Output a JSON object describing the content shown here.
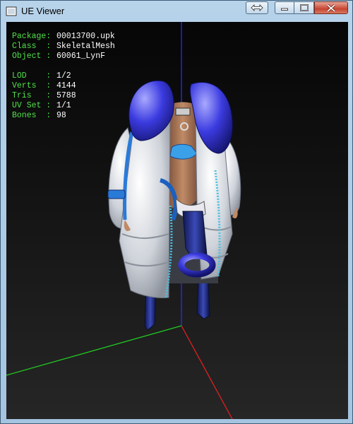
{
  "window": {
    "title": "UE Viewer"
  },
  "info": {
    "package": {
      "key": "Package:",
      "value": "00013700.upk"
    },
    "class": {
      "key": "Class  :",
      "value": "SkeletalMesh"
    },
    "object": {
      "key": "Object :",
      "value": "60061_LynF"
    },
    "lod": {
      "key": "LOD    :",
      "value": "1/2"
    },
    "verts": {
      "key": "Verts  :",
      "value": "4144"
    },
    "tris": {
      "key": "Tris   :",
      "value": "5788"
    },
    "uvset": {
      "key": "UV Set :",
      "value": "1/1"
    },
    "bones": {
      "key": "Bones  :",
      "value": "98"
    }
  },
  "colors": {
    "info_key": "#52e04a",
    "info_value": "#ffffff",
    "axis_x": "#e02020",
    "axis_y": "#22c822",
    "axis_z": "#2a2aff",
    "coat": "#d8dbe0",
    "collar": "#3a3ad8"
  },
  "icons": {
    "app": "ue-viewer-icon",
    "swap": "swap-arrows-icon",
    "minimize": "minimize-icon",
    "maximize": "maximize-icon",
    "close": "close-icon"
  }
}
